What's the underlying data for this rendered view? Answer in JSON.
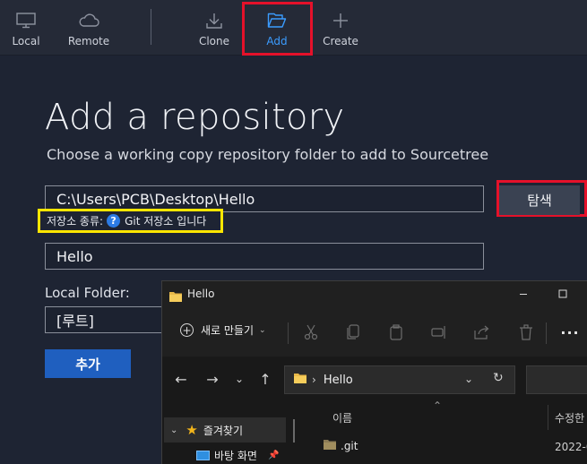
{
  "toolbar": {
    "items": [
      {
        "label": "Local",
        "icon": "monitor-icon"
      },
      {
        "label": "Remote",
        "icon": "cloud-icon"
      },
      {
        "label": "Clone",
        "icon": "download-icon"
      },
      {
        "label": "Add",
        "icon": "folder-open-icon"
      },
      {
        "label": "Create",
        "icon": "plus-icon"
      }
    ],
    "active": "Add"
  },
  "panel": {
    "title": "Add a repository",
    "subtitle": "Choose a working copy repository folder to add to Sourcetree",
    "path_value": "C:\\Users\\PCB\\Desktop\\Hello",
    "browse_label": "탐색",
    "repo_type_prefix": "저장소 종류:",
    "repo_type_value": "Git 저장소 입니다",
    "name_value": "Hello",
    "local_folder_label": "Local Folder:",
    "local_folder_value": "[루트]",
    "add_button": "추가"
  },
  "explorer": {
    "title": "Hello",
    "new_button": "새로 만들기",
    "address_folder": "Hello",
    "sidebar": {
      "quick_access": "즐겨찾기",
      "desktop": "바탕 화면"
    },
    "columns": {
      "name": "이름",
      "modified": "수정한"
    },
    "files": [
      {
        "name": ".git",
        "date": "2022-0"
      }
    ]
  },
  "colors": {
    "accent": "#3b9cff",
    "highlight_red": "#e5112a",
    "highlight_yellow": "#ffe600",
    "add_button": "#1f5fbf"
  }
}
